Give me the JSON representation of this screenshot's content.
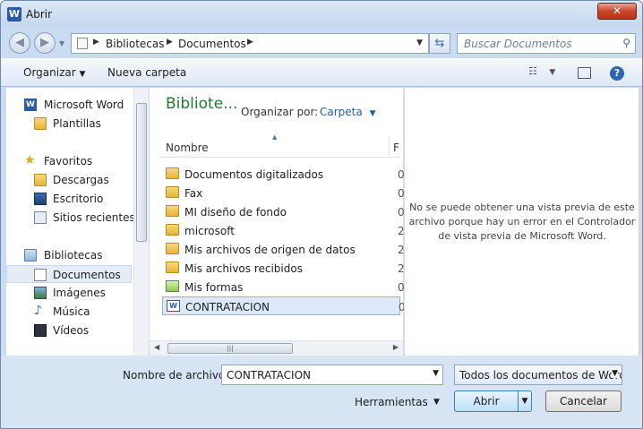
{
  "window": {
    "title": "Abrir",
    "app_icon_letter": "W",
    "close_glyph": "✕"
  },
  "nav": {
    "breadcrumb": [
      "Bibliotecas",
      "Documentos"
    ],
    "search_placeholder": "Buscar Documentos"
  },
  "toolbar": {
    "organize": "Organizar",
    "new_folder": "Nueva carpeta",
    "help": "?"
  },
  "sidebar": {
    "items": [
      {
        "label": "Microsoft Word",
        "icon": "word-icon"
      },
      {
        "label": "Plantillas",
        "icon": "folder-icon"
      },
      {
        "label": "Favoritos",
        "icon": "star-icon"
      },
      {
        "label": "Descargas",
        "icon": "downloads-icon"
      },
      {
        "label": "Escritorio",
        "icon": "desktop-icon"
      },
      {
        "label": "Sitios recientes",
        "icon": "recent-places-icon"
      },
      {
        "label": "Bibliotecas",
        "icon": "libraries-icon"
      },
      {
        "label": "Documentos",
        "icon": "documents-icon",
        "selected": true
      },
      {
        "label": "Imágenes",
        "icon": "pictures-icon"
      },
      {
        "label": "Música",
        "icon": "music-icon"
      },
      {
        "label": "Vídeos",
        "icon": "videos-icon"
      }
    ]
  },
  "file_list": {
    "library_title": "Bibliote...",
    "arrange_by_label": "Organizar por:",
    "arrange_by_value": "Carpeta",
    "column_name": "Nombre",
    "column_date": "F",
    "rows": [
      {
        "name": "Documentos digitalizados",
        "icon": "folder-icon",
        "date": "0"
      },
      {
        "name": "Fax",
        "icon": "folder-icon",
        "date": "0"
      },
      {
        "name": "MI diseño de fondo",
        "icon": "folder-icon",
        "date": "0"
      },
      {
        "name": "microsoft",
        "icon": "folder-icon",
        "date": "2"
      },
      {
        "name": "Mis archivos de origen de datos",
        "icon": "data-sources-folder-icon",
        "date": "2"
      },
      {
        "name": "Mis archivos recibidos",
        "icon": "folder-icon",
        "date": "2"
      },
      {
        "name": "Mis formas",
        "icon": "shapes-folder-icon",
        "date": "0"
      },
      {
        "name": "CONTRATACION",
        "icon": "word-document-icon",
        "date": "0",
        "selected": true
      }
    ]
  },
  "preview": {
    "message": "No se puede obtener una vista previa de este archivo porque hay un error en el Controlador de vista previa de Microsoft Word."
  },
  "footer": {
    "filename_label": "Nombre de archivo:",
    "filename_value": "CONTRATACION",
    "filetype_value": "Todos los documentos de Word",
    "tools_label": "Herramientas",
    "open_label": "Abrir",
    "cancel_label": "Cancelar"
  }
}
